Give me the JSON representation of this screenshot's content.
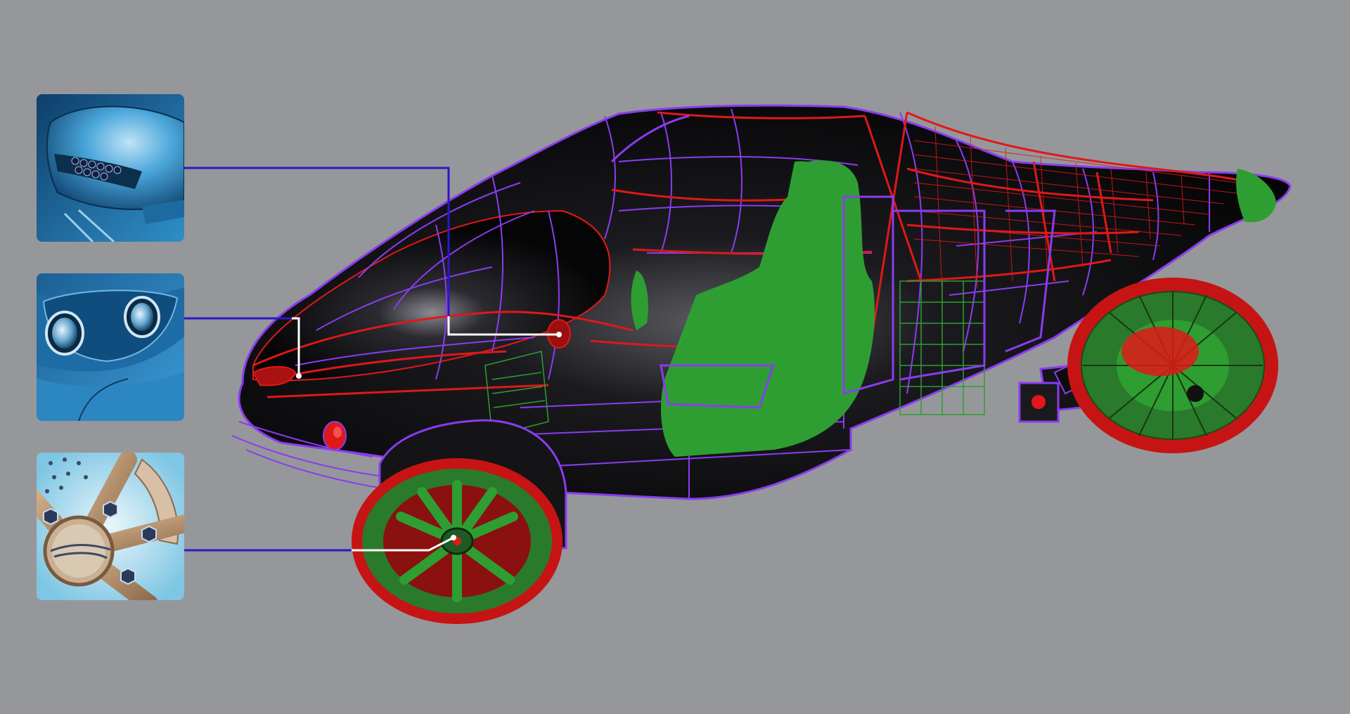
{
  "image": {
    "subject": "car-cad-wireframe",
    "background_color": "#96979a"
  },
  "colors": {
    "body_black": "#0c0c0e",
    "wire_purple": "#8a3cf0",
    "wire_red": "#e01818",
    "interior_green": "#2e9e32",
    "tire_red": "#c61414",
    "callout_line_blue": "#2a18c8",
    "callout_line_white": "#ffffff",
    "thumb_blue": "#2e7fb8"
  },
  "callouts": [
    {
      "name": "mirror-detail",
      "icon": "side-mirror-icon"
    },
    {
      "name": "fog-lamp-detail",
      "icon": "lamp-icon"
    },
    {
      "name": "wheel-hub-detail",
      "icon": "wheel-icon"
    }
  ]
}
